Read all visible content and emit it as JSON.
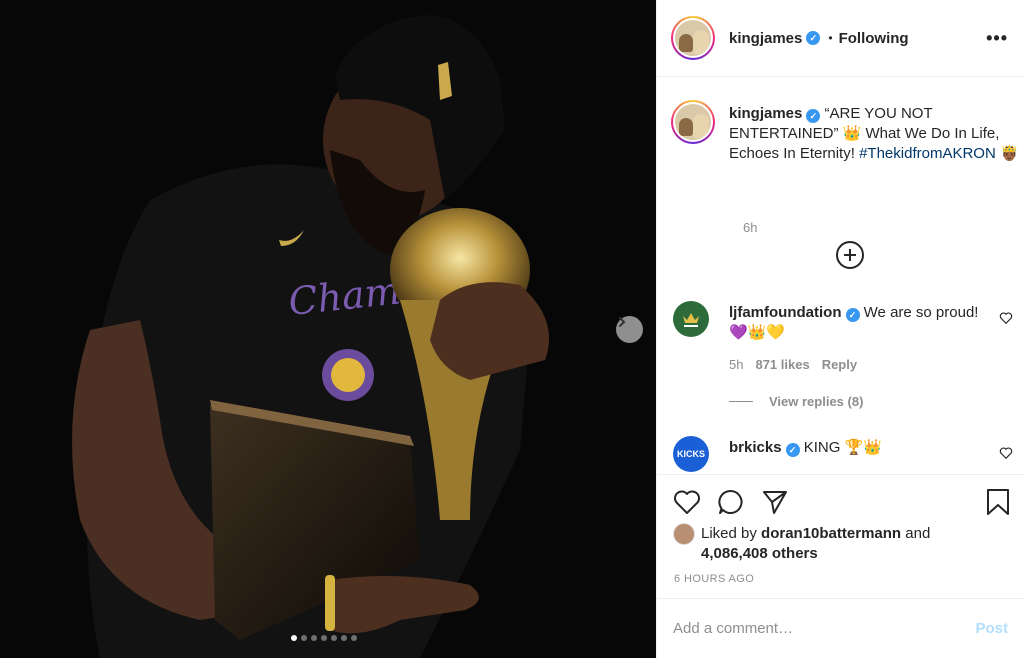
{
  "post": {
    "username": "kingjames",
    "follow_status": "Following",
    "more_label": "•••",
    "caption_text": "“ARE YOU NOT ENTERTAINED” 👑 What We Do In Life, Echoes In Eternity! ",
    "caption_hashtag": "#ThekidfromAKRON",
    "caption_end": "🤴🏾",
    "caption_time": "6h",
    "photo_index": 1,
    "photo_count": 7
  },
  "comments": [
    {
      "username": "ljfamfoundation",
      "text": "We are so proud! 💜👑💛",
      "time": "5h",
      "likes": "871 likes",
      "reply_label": "Reply",
      "view_replies": "View replies (8)"
    },
    {
      "username": "brkicks",
      "text": "KING 🏆👑"
    }
  ],
  "likes": {
    "prefix": "Liked by ",
    "liker": "doran10battermann",
    "middle": " and",
    "others": "4,086,408 others"
  },
  "timeago": "6 HOURS AGO",
  "comment_box": {
    "placeholder": "Add a comment…",
    "post_label": "Post"
  },
  "icons": {
    "verified": "verified-badge-icon",
    "next": "chevron-right-icon",
    "load_more": "plus-circle-icon",
    "like": "heart-icon",
    "comment": "comment-icon",
    "share": "paper-plane-icon",
    "save": "bookmark-icon"
  },
  "colors": {
    "verified": "#3897f0",
    "hashtag": "#00376b",
    "muted": "#8e8e8e",
    "post_disabled": "#b2dffc",
    "foundation_green": "#2e6b3a",
    "brkicks_blue": "#1a5fd6"
  }
}
